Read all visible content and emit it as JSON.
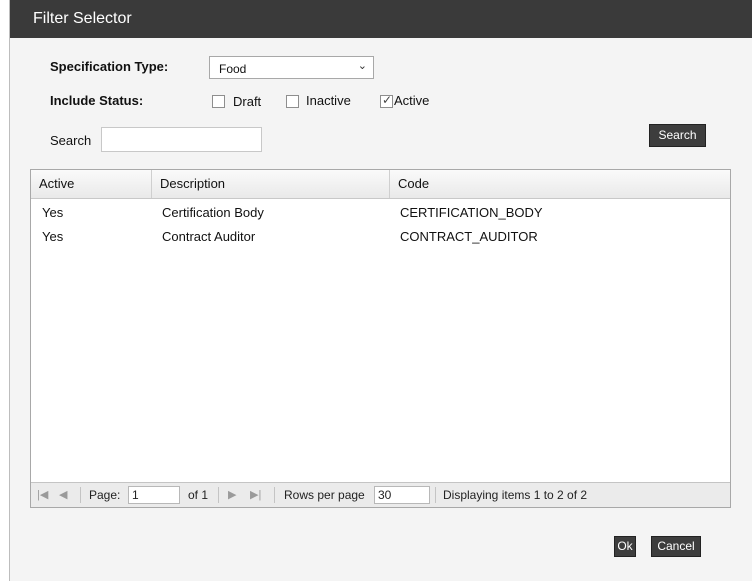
{
  "dialog": {
    "title": "Filter Selector"
  },
  "form": {
    "spec_type_label": "Specification Type:",
    "spec_type_value": "Food",
    "include_status_label": "Include Status:",
    "statuses": [
      {
        "label": "Draft",
        "checked": false
      },
      {
        "label": "Inactive",
        "checked": false
      },
      {
        "label": "Active",
        "checked": true
      }
    ],
    "search_label": "Search",
    "search_value": "",
    "search_button": "Search"
  },
  "table": {
    "columns": [
      "Active",
      "Description",
      "Code"
    ],
    "rows": [
      [
        "Yes",
        "Certification Body",
        "CERTIFICATION_BODY"
      ],
      [
        "Yes",
        "Contract Auditor",
        "CONTRACT_AUDITOR"
      ]
    ]
  },
  "pager": {
    "page_label": "Page:",
    "page_value": "1",
    "of_text": "of 1",
    "rows_label": "Rows per page",
    "rows_value": "30",
    "display_text": "Displaying items 1 to 2 of 2"
  },
  "footer": {
    "ok": "Ok",
    "cancel": "Cancel"
  }
}
